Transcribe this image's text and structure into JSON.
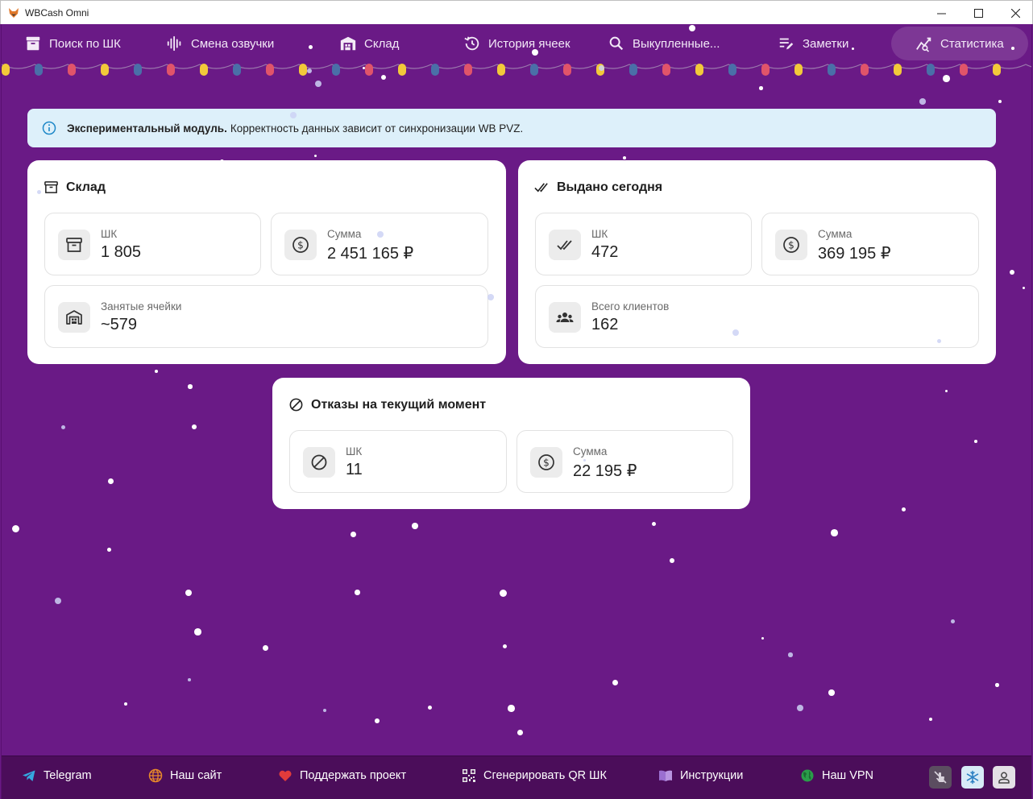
{
  "window": {
    "title": "WBCash Omni"
  },
  "nav": {
    "items": [
      {
        "label": "Поиск по ШК",
        "icon": "archive-box-icon"
      },
      {
        "label": "Смена озвучки",
        "icon": "voice-wave-icon"
      },
      {
        "label": "Склад",
        "icon": "warehouse-icon"
      },
      {
        "label": "История ячеек",
        "icon": "history-icon"
      },
      {
        "label": "Выкупленные...",
        "icon": "search-icon"
      },
      {
        "label": "Заметки",
        "icon": "notes-edit-icon"
      },
      {
        "label": "Статистика",
        "icon": "stats-chart-icon",
        "active": true
      }
    ]
  },
  "banner": {
    "bold": "Экспериментальный модуль.",
    "text": "Корректность данных зависит от синхронизации WB PVZ."
  },
  "warehouse": {
    "title": "Склад",
    "shk_label": "ШК",
    "shk_value": "1 805",
    "sum_label": "Сумма",
    "sum_value": "2 451 165 ₽",
    "cells_label": "Занятые ячейки",
    "cells_value": "~579"
  },
  "issued": {
    "title": "Выдано сегодня",
    "shk_label": "ШК",
    "shk_value": "472",
    "sum_label": "Сумма",
    "sum_value": "369 195 ₽",
    "clients_label": "Всего клиентов",
    "clients_value": "162"
  },
  "refusals": {
    "title": "Отказы на текущий момент",
    "shk_label": "ШК",
    "shk_value": "11",
    "sum_label": "Сумма",
    "sum_value": "22 195 ₽"
  },
  "footer": {
    "telegram": "Telegram",
    "site": "Наш сайт",
    "support": "Поддержать проект",
    "qr": "Сгенерировать QR ШК",
    "instructions": "Инструкции",
    "vpn": "Наш VPN"
  },
  "colors": {
    "background": "#6a1a86",
    "footer": "#4b0d5a",
    "banner": "#ddf0fa",
    "info_icon": "#1e88c8"
  }
}
